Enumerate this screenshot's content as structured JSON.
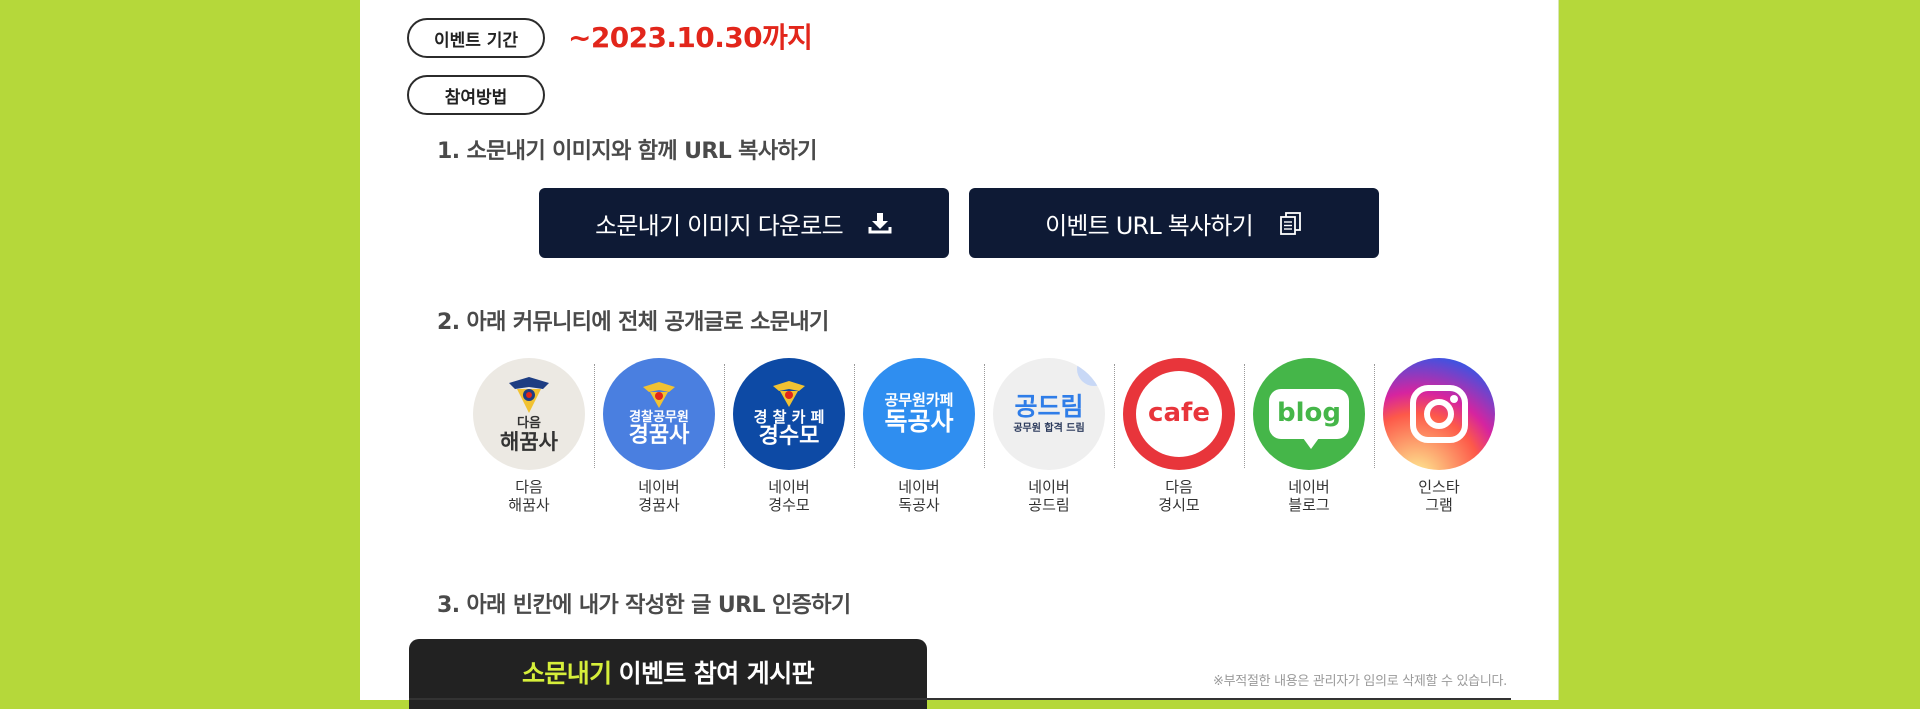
{
  "event": {
    "period_label": "이벤트 기간",
    "deadline": "~2023.10.30까지",
    "method_label": "참여방법"
  },
  "steps": {
    "step1": "1. 소문내기 이미지와 함께 URL 복사하기",
    "step2": "2. 아래 커뮤니티에 전체 공개글로 소문내기",
    "step3": "3. 아래 빈칸에 내가 작성한 글 URL 인증하기"
  },
  "buttons": {
    "download_label": "소문내기 이미지 다운로드",
    "download_icon": "download-icon",
    "copy_label": "이벤트 URL 복사하기",
    "copy_icon": "copy-icon",
    "background": "#0e1a35"
  },
  "communities": [
    {
      "line1": "다음",
      "line2": "해꿈사",
      "logo_top": "다음",
      "logo_main": "해꿈사",
      "color": "#ece9e3"
    },
    {
      "line1": "네이버",
      "line2": "경꿈사",
      "logo_top": "경찰공무원",
      "logo_main": "경꿈사",
      "color": "#4a7fe0"
    },
    {
      "line1": "네이버",
      "line2": "경수모",
      "logo_top": "경 찰 카 페",
      "logo_main": "경수모",
      "color": "#0d4aa5"
    },
    {
      "line1": "네이버",
      "line2": "독공사",
      "logo_top": "공무원카페",
      "logo_main": "독공사",
      "color": "#2f8ef0"
    },
    {
      "line1": "네이버",
      "line2": "공드림",
      "logo_top": "공드림",
      "logo_main": "공무원 합격 드림",
      "color": "#efefef"
    },
    {
      "line1": "다음",
      "line2": "경시모",
      "logo_top": "cafe",
      "logo_main": "",
      "color": "#e8353b"
    },
    {
      "line1": "네이버",
      "line2": "블로그",
      "logo_top": "blog",
      "logo_main": "",
      "color": "#45b649"
    },
    {
      "line1": "인스타",
      "line2": "그램",
      "logo_top": "",
      "logo_main": "",
      "color": "#c13584"
    }
  ],
  "board": {
    "highlight": "소문내기",
    "title": "이벤트 참여 게시판",
    "notice": "※부적절한 내용은 관리자가 임의로 삭제할 수 있습니다."
  },
  "colors": {
    "background": "#b5d83a",
    "deadline": "#e2261b",
    "board_highlight": "#d6ef3a"
  }
}
